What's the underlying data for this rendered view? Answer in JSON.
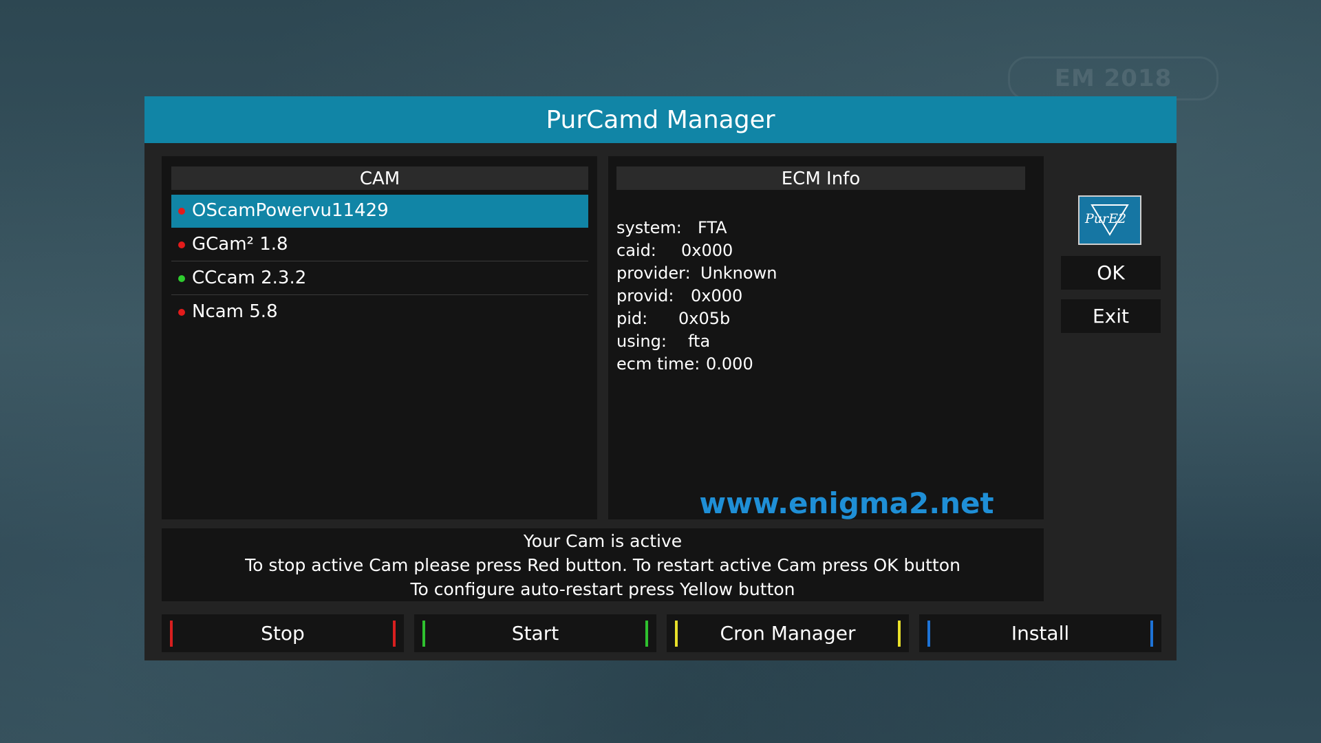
{
  "dialog": {
    "title": "PurCamd Manager"
  },
  "cam_panel": {
    "header": "CAM",
    "items": [
      {
        "name": "OScamPowervu11429",
        "status_color": "#e31b1b",
        "selected": true
      },
      {
        "name": "GCam² 1.8",
        "status_color": "#e31b1b",
        "selected": false
      },
      {
        "name": "CCcam 2.3.2",
        "status_color": "#2ecc2e",
        "selected": false
      },
      {
        "name": "Ncam 5.8",
        "status_color": "#e31b1b",
        "selected": false
      }
    ]
  },
  "ecm_panel": {
    "header": "ECM Info",
    "rows": [
      {
        "key": "system:",
        "value": "FTA"
      },
      {
        "key": "caid:",
        "value": "0x000"
      },
      {
        "key": "provider:",
        "value": "Unknown"
      },
      {
        "key": "provid:",
        "value": "0x000"
      },
      {
        "key": "pid:",
        "value": "0x05b"
      },
      {
        "key": "using:",
        "value": "fta"
      },
      {
        "key": "ecm time:",
        "value": "0.000"
      }
    ],
    "watermark": "www.enigma2.net"
  },
  "side": {
    "logo_text": "PurE2",
    "ok_label": "OK",
    "exit_label": "Exit"
  },
  "message": {
    "lines": [
      "Your Cam is active",
      "To stop active Cam please press Red button. To restart active Cam press OK button",
      "To configure auto-restart press Yellow button"
    ]
  },
  "color_buttons": {
    "red": {
      "label": "Stop",
      "color": "#d81f1f"
    },
    "green": {
      "label": "Start",
      "color": "#2fc12f"
    },
    "yellow": {
      "label": "Cron Manager",
      "color": "#e8e02a"
    },
    "blue": {
      "label": "Install",
      "color": "#1e73d6"
    }
  },
  "background": {
    "emblem_text": "EM 2018"
  },
  "colors": {
    "accent": "#1185a6",
    "panel": "#141414",
    "dialog": "#232323"
  }
}
